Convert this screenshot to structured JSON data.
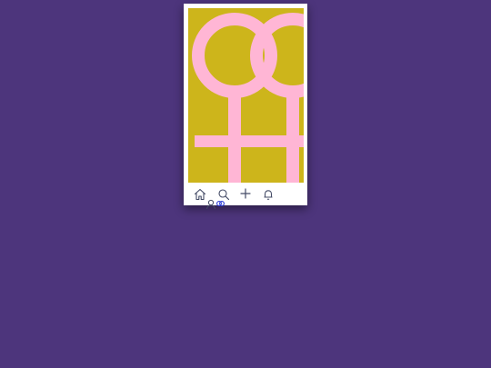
{
  "colors": {
    "page_background": "#4d357c",
    "device_frame": "#ffffff",
    "poster_background": "#cdb51b",
    "symbol": "#ffb6d5",
    "nav_icon": "#444b66",
    "profile_accent": "#2b3bd6"
  },
  "poster": {
    "symbol": "double-venus-symbol"
  },
  "bottom_nav": {
    "items": [
      {
        "icon": "home-icon"
      },
      {
        "icon": "search-icon"
      },
      {
        "icon": "plus-icon"
      },
      {
        "icon": "bell-icon"
      },
      {
        "icon": "profile-icon"
      }
    ]
  }
}
